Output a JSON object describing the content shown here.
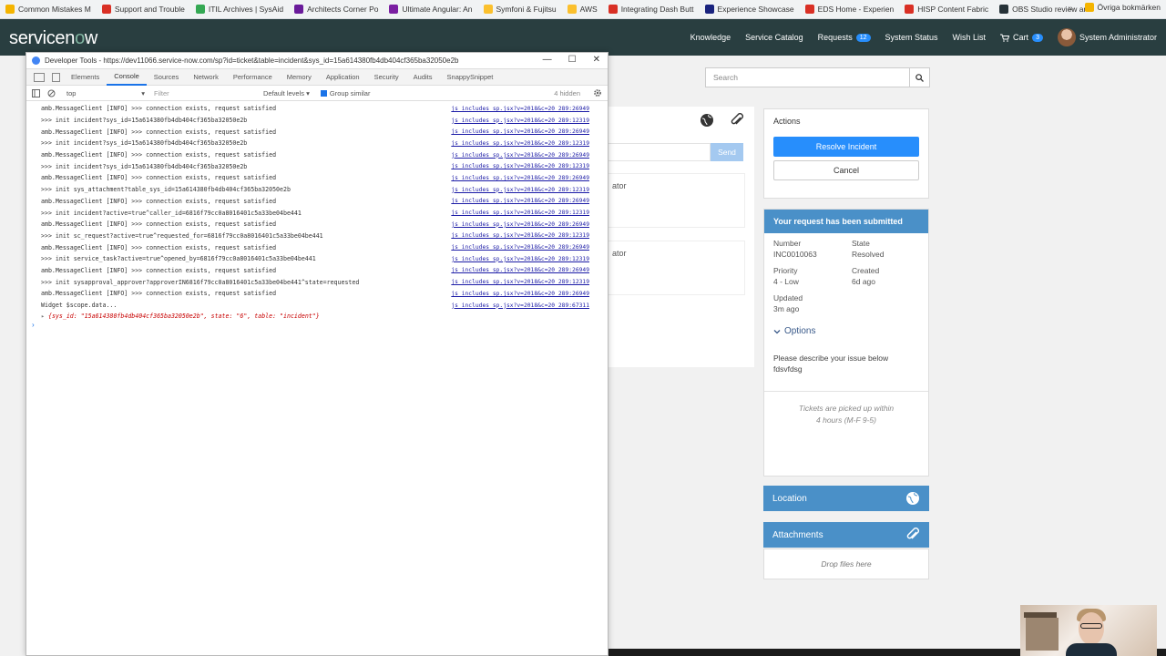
{
  "bookmarks": {
    "items": [
      {
        "label": "Common Mistakes M",
        "color": "#f4b400"
      },
      {
        "label": "Support and Trouble",
        "color": "#d93025"
      },
      {
        "label": "ITIL Archives | SysAid",
        "color": "#34a853"
      },
      {
        "label": "Architects Corner Po",
        "color": "#6a1b9a"
      },
      {
        "label": "Ultimate Angular: An",
        "color": "#7b1fa2"
      },
      {
        "label": "Symfoni & Fujitsu",
        "color": "#fbc02d"
      },
      {
        "label": "AWS",
        "color": "#fbc02d"
      },
      {
        "label": "Integrating Dash Butt",
        "color": "#d93025"
      },
      {
        "label": "Experience Showcase",
        "color": "#1a237e"
      },
      {
        "label": "EDS Home - Experien",
        "color": "#d93025"
      },
      {
        "label": "HISP Content Fabric",
        "color": "#d93025"
      },
      {
        "label": "OBS Studio review an",
        "color": "#263238"
      }
    ],
    "more": "»",
    "other": "Övriga bokmärken"
  },
  "header": {
    "logo_part1": "servicen",
    "logo_o": "o",
    "logo_part2": "w",
    "nav": {
      "knowledge": "Knowledge",
      "service_catalog": "Service Catalog",
      "requests": "Requests",
      "requests_count": "12",
      "system_status": "System Status",
      "wish_list": "Wish List",
      "cart": "Cart",
      "cart_count": "3",
      "user": "System Administrator"
    }
  },
  "search": {
    "placeholder": "Search"
  },
  "content": {
    "send": "Send",
    "entry1": "ator",
    "entry2": "ator"
  },
  "actions": {
    "title": "Actions",
    "resolve": "Resolve Incident",
    "cancel": "Cancel"
  },
  "ticket": {
    "heading": "Your request has been submitted",
    "number_label": "Number",
    "number_value": "INC0010063",
    "state_label": "State",
    "state_value": "Resolved",
    "priority_label": "Priority",
    "priority_value": "4 - Low",
    "created_label": "Created",
    "created_value": "6d ago",
    "updated_label": "Updated",
    "updated_value": "3m ago",
    "options": "Options",
    "desc_label": "Please describe your issue below",
    "desc_value": "fdsvfdsg",
    "note_line1": "Tickets are picked up within",
    "note_line2": "4 hours (M-F 9-5)"
  },
  "location": {
    "title": "Location"
  },
  "attachments": {
    "title": "Attachments",
    "drop": "Drop files here"
  },
  "devtools": {
    "title": "Developer Tools - https://dev11066.service-now.com/sp?id=ticket&table=incident&sys_id=15a614380fb4db404cf365ba32050e2b",
    "tabs": [
      "Elements",
      "Console",
      "Sources",
      "Network",
      "Performance",
      "Memory",
      "Application",
      "Security",
      "Audits",
      "SnappySnippet"
    ],
    "context": "top",
    "filter_placeholder": "Filter",
    "levels": "Default levels ▾",
    "group_similar": "Group similar",
    "hidden": "4 hidden",
    "lines": [
      {
        "text": "amb.MessageClient [INFO] >>> connection exists, request satisfied",
        "src": "js_includes_sp.jsx?v=2018&c=20_289:26949"
      },
      {
        "text": ">>> init incident?sys_id=15a614380fb4db404cf365ba32050e2b",
        "src": "js_includes_sp.jsx?v=2018&c=20_289:12319"
      },
      {
        "text": "amb.MessageClient [INFO] >>> connection exists, request satisfied",
        "src": "js_includes_sp.jsx?v=2018&c=20_289:26949"
      },
      {
        "text": ">>> init incident?sys_id=15a614380fb4db404cf365ba32050e2b",
        "src": "js_includes_sp.jsx?v=2018&c=20_289:12319"
      },
      {
        "text": "amb.MessageClient [INFO] >>> connection exists, request satisfied",
        "src": "js_includes_sp.jsx?v=2018&c=20_289:26949"
      },
      {
        "text": ">>> init incident?sys_id=15a614380fb4db404cf365ba32050e2b",
        "src": "js_includes_sp.jsx?v=2018&c=20_289:12319"
      },
      {
        "text": "amb.MessageClient [INFO] >>> connection exists, request satisfied",
        "src": "js_includes_sp.jsx?v=2018&c=20_289:26949"
      },
      {
        "text": ">>> init sys_attachment?table_sys_id=15a614380fb4db404cf365ba32050e2b",
        "src": "js_includes_sp.jsx?v=2018&c=20_289:12319"
      },
      {
        "text": "amb.MessageClient [INFO] >>> connection exists, request satisfied",
        "src": "js_includes_sp.jsx?v=2018&c=20_289:26949"
      },
      {
        "text": ">>> init incident?active=true^caller_id=6816f79cc0a8016401c5a33be04be441",
        "src": "js_includes_sp.jsx?v=2018&c=20_289:12319"
      },
      {
        "text": "amb.MessageClient [INFO] >>> connection exists, request satisfied",
        "src": "js_includes_sp.jsx?v=2018&c=20_289:26949"
      },
      {
        "text": ">>> init sc_request?active=true^requested_for=6816f79cc0a8016401c5a33be04be441",
        "src": "js_includes_sp.jsx?v=2018&c=20_289:12319"
      },
      {
        "text": "amb.MessageClient [INFO] >>> connection exists, request satisfied",
        "src": "js_includes_sp.jsx?v=2018&c=20_289:26949"
      },
      {
        "text": ">>> init service_task?active=true^opened_by=6816f79cc0a8016401c5a33be04be441",
        "src": "js_includes_sp.jsx?v=2018&c=20_289:12319"
      },
      {
        "text": "amb.MessageClient [INFO] >>> connection exists, request satisfied",
        "src": "js_includes_sp.jsx?v=2018&c=20_289:26949"
      },
      {
        "text": ">>> init sysapproval_approver?approverIN6816f79cc0a8016401c5a33be04be441^state=requested",
        "src": "js_includes_sp.jsx?v=2018&c=20_289:12319"
      },
      {
        "text": "amb.MessageClient [INFO] >>> connection exists, request satisfied",
        "src": "js_includes_sp.jsx?v=2018&c=20_289:26949"
      },
      {
        "text": "Widget $scope.data...",
        "src": "js_includes_sp.jsx?v=2018&c=20_289:67311"
      }
    ],
    "object_line": "{sys_id: \"15a614380fb4db404cf365ba32050e2b\", state: \"6\", table: \"incident\"}",
    "prompt": "›"
  }
}
